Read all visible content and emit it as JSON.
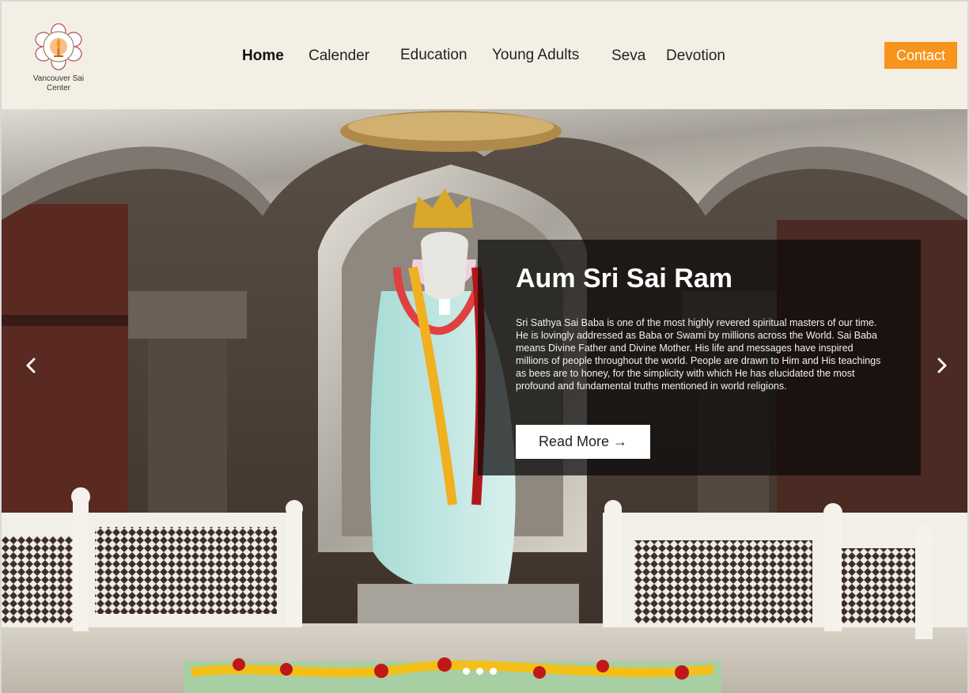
{
  "header": {
    "logo_text": "Vancouver Sai Center",
    "nav": [
      {
        "label": "Home",
        "active": true
      },
      {
        "label": "Calender",
        "active": false
      },
      {
        "label": "Education",
        "active": false
      },
      {
        "label": "Young Adults",
        "active": false
      },
      {
        "label": "Seva",
        "active": false
      },
      {
        "label": "Devotion",
        "active": false
      }
    ],
    "contact_label": "Contact"
  },
  "hero": {
    "title": "Aum Sri Sai Ram",
    "description": "Sri Sathya Sai Baba is one of the most highly revered spiritual masters of our time. He is lovingly addressed as Baba or Swami by millions across the World. Sai Baba means Divine Father and Divine Mother. His life and messages have inspired millions of people throughout the world. People are drawn to Him and His teachings as bees are to honey, for the simplicity with which He has elucidated the most profound and fundamental truths mentioned in world religions.",
    "read_more_label": "Read More →",
    "prev_icon": "chevron-left-icon",
    "next_icon": "chevron-right-icon",
    "slide_count": 3
  },
  "colors": {
    "header_bg": "#f3efe4",
    "accent": "#f7941d",
    "overlay": "#0a0808"
  }
}
